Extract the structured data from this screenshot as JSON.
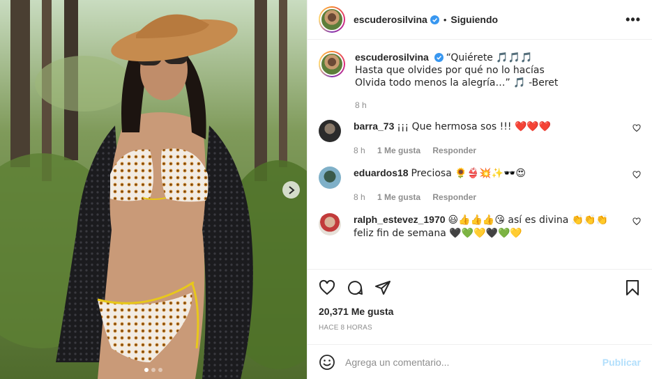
{
  "post": {
    "author": "escuderosilvina",
    "follow_state": "Siguiendo",
    "separator": "•",
    "more_glyph": "•••"
  },
  "caption": {
    "username": "escuderosilvina",
    "line1": "“Quiérete 🎵🎵🎵",
    "line2": "Hasta que olvides por qué no lo hacías",
    "line3": "Olvida todo menos la alegría…” 🎵 -Beret",
    "time": "8 h"
  },
  "comments": [
    {
      "username": "barra_73",
      "text": "¡¡¡ Que hermosa sos !!! ❤️❤️❤️",
      "time": "8 h",
      "likes": "1 Me gusta",
      "reply": "Responder"
    },
    {
      "username": "eduardos18",
      "text": "Preciosa 🌻👙💥✨🕶️😍",
      "time": "8 h",
      "likes": "1 Me gusta",
      "reply": "Responder"
    },
    {
      "username": "ralph_estevez_1970",
      "text": "😃👍👍👍😘 así es divina 👏👏👏 feliz fin de semana 🖤💚💛🖤💚💛"
    }
  ],
  "stats": {
    "likes": "20,371 Me gusta",
    "ago": "Hace 8 horas"
  },
  "composer": {
    "placeholder": "Agrega un comentario...",
    "publish": "Publicar"
  },
  "carousel": {
    "slide_count": 3,
    "active_index": 0
  },
  "colors": {
    "verified": "#3897f0",
    "heart": "#ed4956",
    "publish_disabled": "#b2dffc",
    "meta_gray": "#8e8e8e"
  }
}
